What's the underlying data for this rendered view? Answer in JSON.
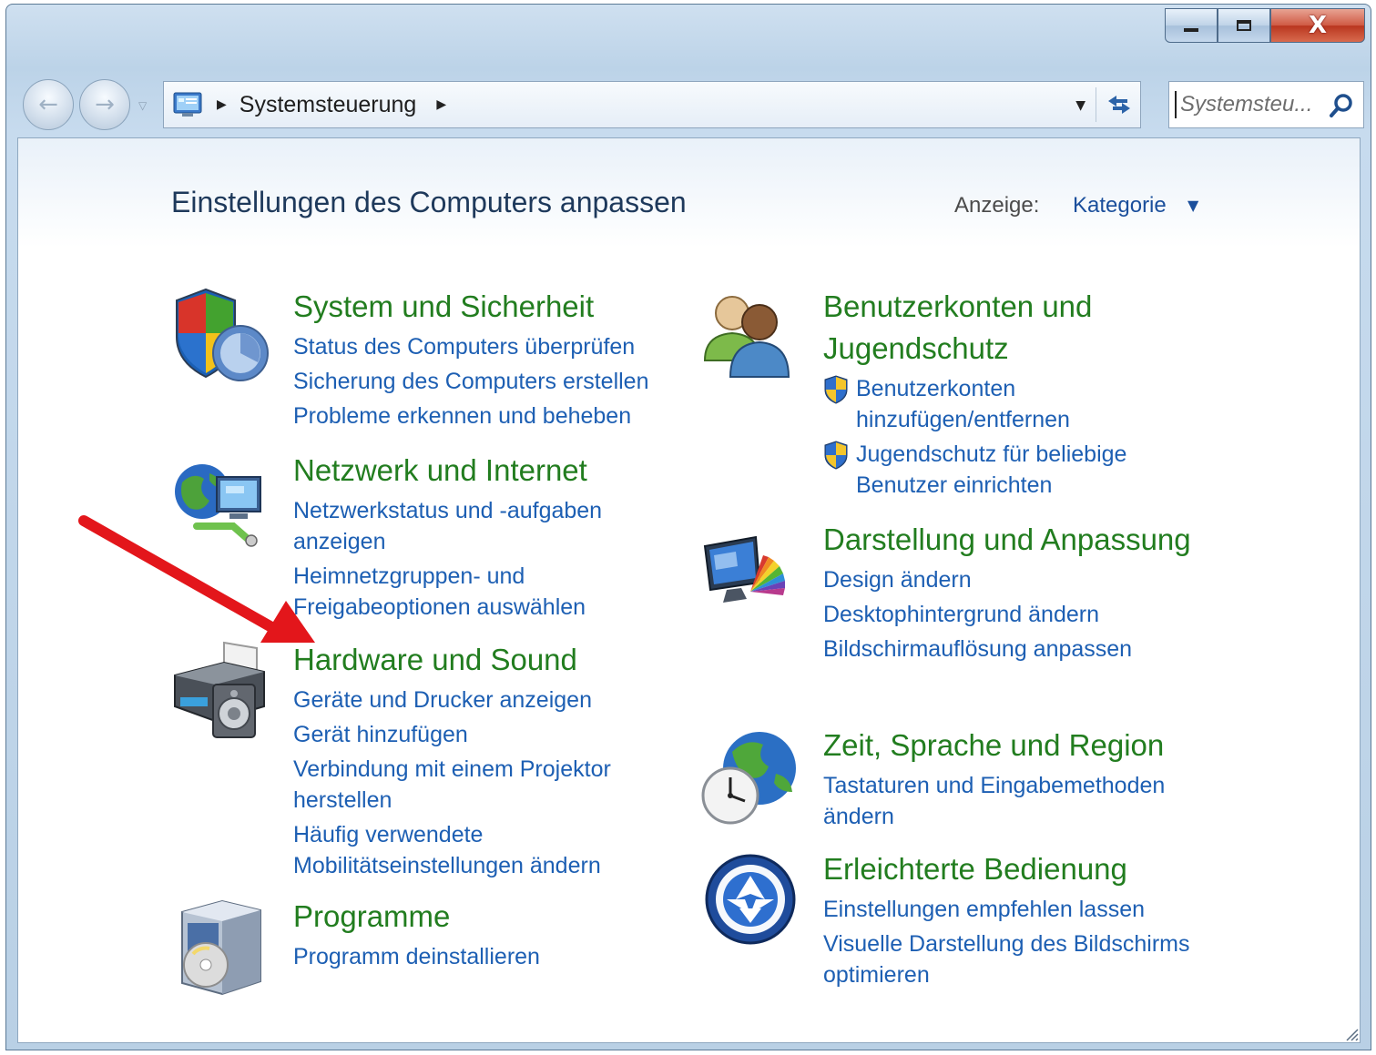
{
  "window": {
    "caption_buttons": {
      "close_glyph": "X"
    }
  },
  "navbar": {
    "breadcrumb": "Systemsteuerung",
    "search_placeholder": "Systemsteu..."
  },
  "header": {
    "title": "Einstellungen des Computers anpassen",
    "view_label": "Anzeige:",
    "view_value": "Kategorie"
  },
  "categories": [
    {
      "title": "System und Sicherheit",
      "icon": "shield-icon",
      "links": [
        "Status des Computers überprüfen",
        "Sicherung des Computers erstellen",
        "Probleme erkennen und beheben"
      ]
    },
    {
      "title": "Netzwerk und Internet",
      "icon": "network-globe-icon",
      "links": [
        "Netzwerkstatus und -aufgaben anzeigen",
        "Heimnetzgruppen- und Freigabeoptionen auswählen"
      ]
    },
    {
      "title": "Hardware und Sound",
      "icon": "printer-speaker-icon",
      "links": [
        "Geräte und Drucker anzeigen",
        "Gerät hinzufügen",
        "Verbindung mit einem Projektor herstellen",
        "Häufig verwendete Mobilitätseinstellungen ändern"
      ]
    },
    {
      "title": "Programme",
      "icon": "programs-box-icon",
      "links": [
        "Programm deinstallieren"
      ]
    },
    {
      "title": "Benutzerkonten und Jugendschutz",
      "icon": "users-icon",
      "links": [
        "Benutzerkonten hinzufügen/entfernen",
        "Jugendschutz für beliebige Benutzer einrichten"
      ]
    },
    {
      "title": "Darstellung und Anpassung",
      "icon": "monitor-palette-icon",
      "links": [
        "Design ändern",
        "Desktophintergrund ändern",
        "Bildschirmauflösung anpassen"
      ]
    },
    {
      "title": "Zeit, Sprache und Region",
      "icon": "clock-globe-icon",
      "links": [
        "Tastaturen und Eingabemethoden ändern"
      ]
    },
    {
      "title": "Erleichterte Bedienung",
      "icon": "accessibility-icon",
      "links": [
        "Einstellungen empfehlen lassen",
        "Visuelle Darstellung des Bildschirms optimieren"
      ]
    }
  ],
  "colors": {
    "category_title": "#227d1f",
    "link": "#1d5fb3",
    "page_title": "#1e395b",
    "annotation_arrow": "#e3161b"
  }
}
